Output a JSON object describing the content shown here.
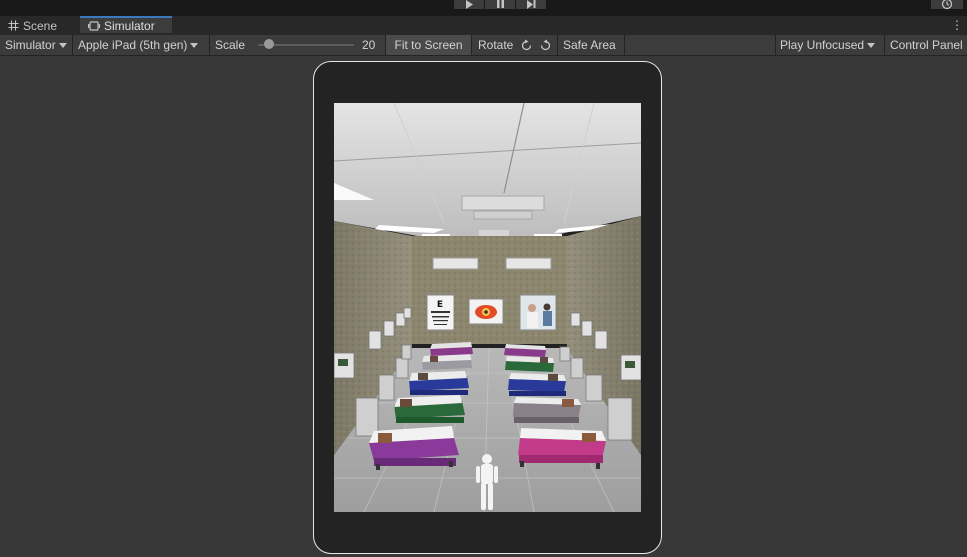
{
  "tabs": [
    {
      "label": "Scene",
      "icon": "grid-icon"
    },
    {
      "label": "Simulator",
      "icon": "device-icon",
      "active": true
    }
  ],
  "toolbar": {
    "mode_dropdown": "Simulator",
    "device_dropdown": "Apple iPad (5th gen)",
    "scale_label": "Scale",
    "scale_value": "20",
    "scale_level": 0.2,
    "fit_button": "Fit to Screen",
    "rotate_label": "Rotate",
    "safe_area_label": "Safe Area",
    "focus_dropdown": "Play Unfocused",
    "control_panel": "Control Panel"
  },
  "play_controls": [
    "play-icon",
    "pause-icon",
    "step-icon"
  ],
  "colors": {
    "accent": "#3a79bb",
    "editor_bg": "#383838",
    "toolbar_bg": "#3c3c3c",
    "device_frame": "#e6e6e6"
  },
  "scene": {
    "description_free": true,
    "poster_icons": [
      "eye-chart-icon",
      "eye-anatomy-icon",
      "doctor-photo-icon"
    ]
  }
}
